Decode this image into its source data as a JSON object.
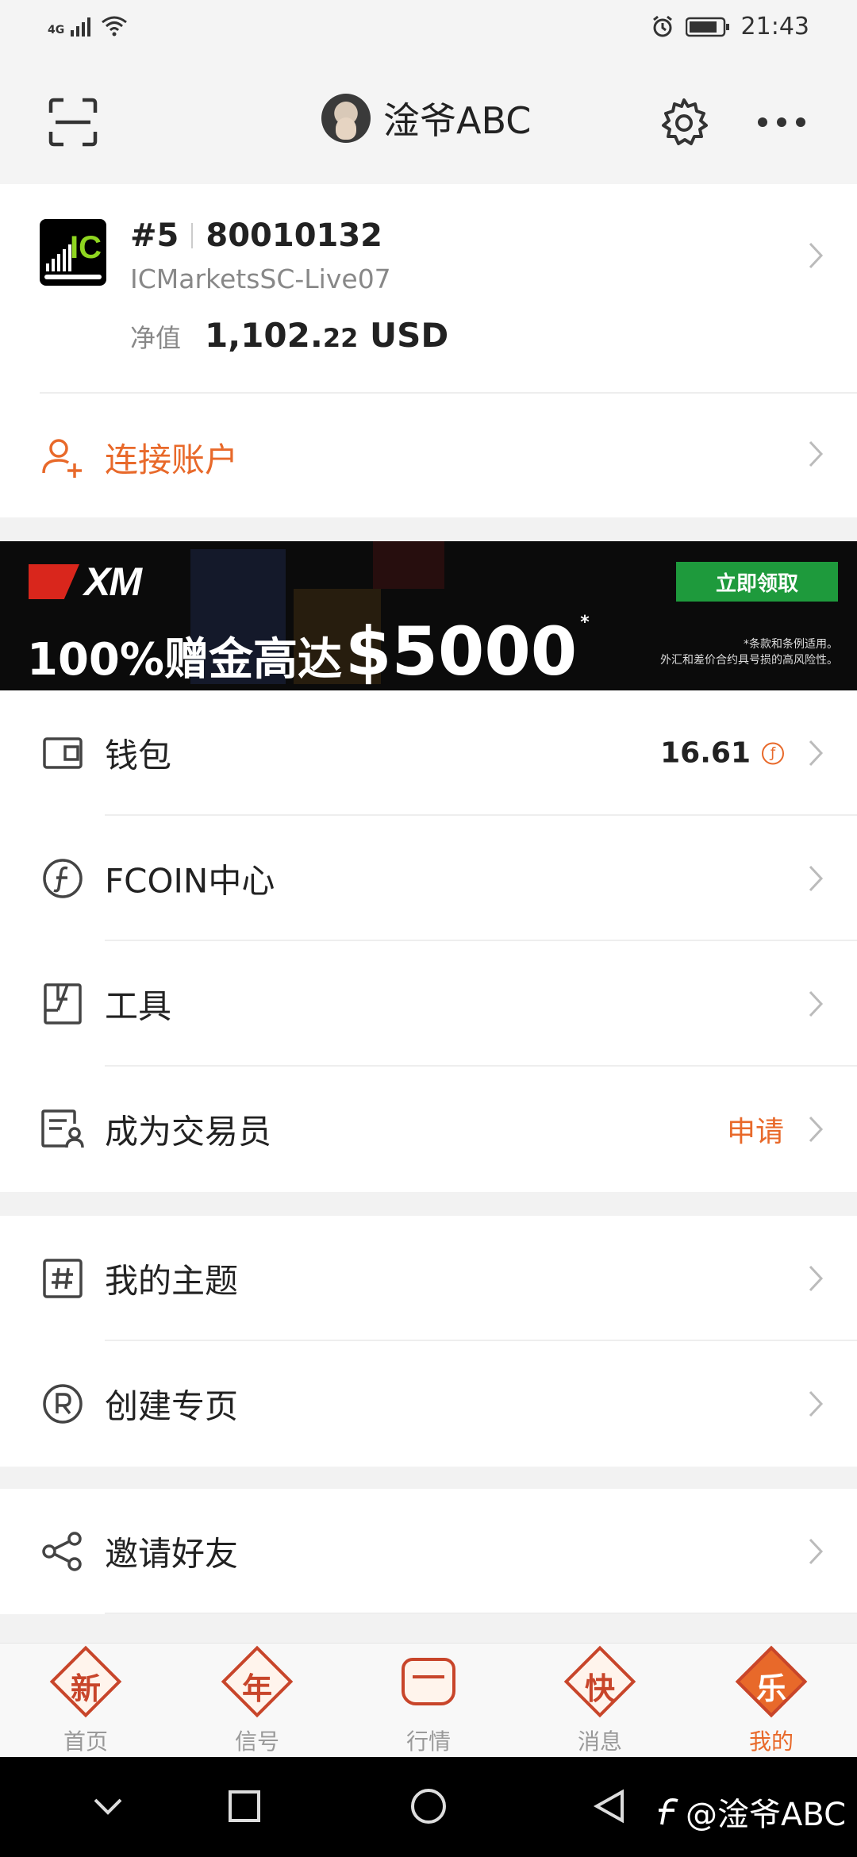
{
  "status_bar": {
    "network": "4G",
    "time": "21:43"
  },
  "header": {
    "username": "淦爷ABC"
  },
  "account": {
    "rank": "#5",
    "number": "80010132",
    "server": "ICMarketsSC-Live07",
    "equity_label": "净值",
    "equity_main": "1,102.",
    "equity_decimals": "22",
    "equity_currency": "USD",
    "logo_text": "IC"
  },
  "connect": {
    "label": "连接账户"
  },
  "banner": {
    "brand": "XM",
    "promo_text": "100%赠金高达",
    "promo_amount": "$5000",
    "promo_mark": "*",
    "cta": "立即领取",
    "terms_line1": "*条款和条例适用。",
    "terms_line2": "外汇和差价合约具号损的高风险性。"
  },
  "menu1": {
    "wallet": {
      "label": "钱包",
      "value": "16.61"
    },
    "fcoin": {
      "label": "FCOIN中心"
    },
    "tools": {
      "label": "工具"
    },
    "trader": {
      "label": "成为交易员",
      "action": "申请"
    }
  },
  "menu2": {
    "topics": {
      "label": "我的主题"
    },
    "page": {
      "label": "创建专页"
    }
  },
  "menu3": {
    "invite": {
      "label": "邀请好友"
    }
  },
  "tabbar": [
    {
      "glyph": "新",
      "label": "首页"
    },
    {
      "glyph": "年",
      "label": "信号"
    },
    {
      "glyph": "",
      "label": "行情"
    },
    {
      "glyph": "快",
      "label": "消息"
    },
    {
      "glyph": "乐",
      "label": "我的"
    }
  ],
  "watermark": {
    "text": "@淦爷ABC"
  },
  "colors": {
    "accent": "#e8692a",
    "tab_red": "#c8452a",
    "green_btn": "#1e9a3c"
  }
}
